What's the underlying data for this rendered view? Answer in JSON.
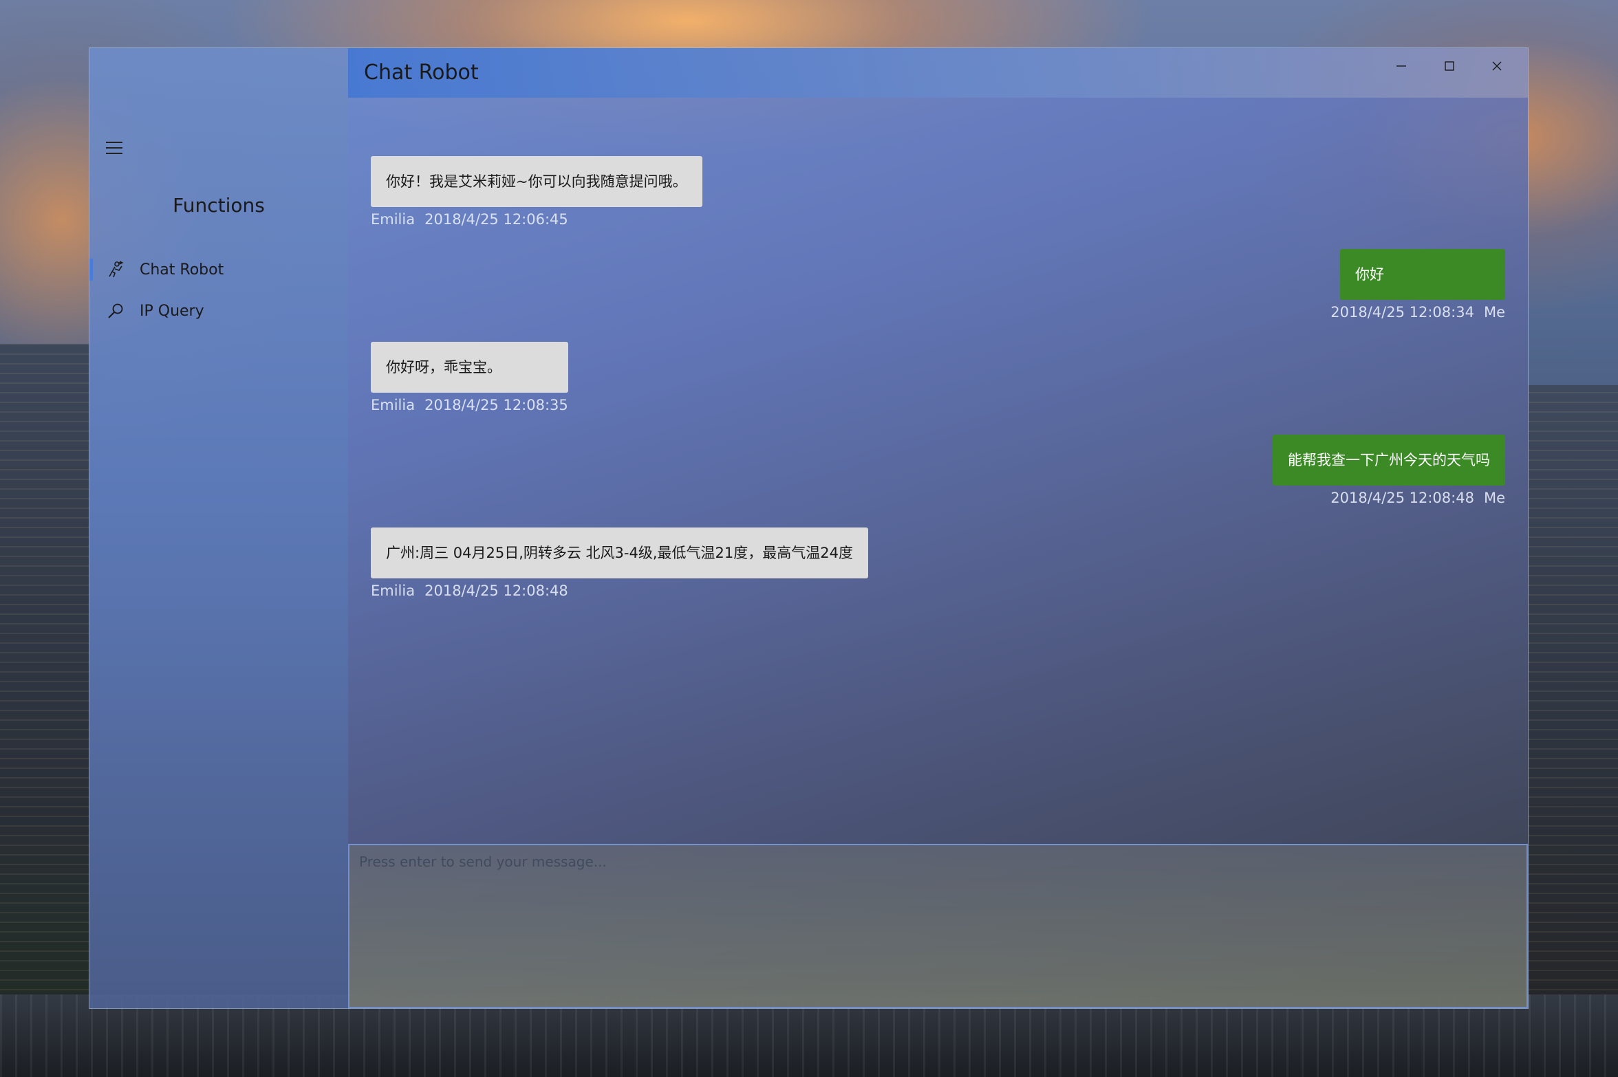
{
  "window": {
    "title": "Chat Robot",
    "caption_buttons": {
      "minimize_icon": "minimize-icon",
      "maximize_icon": "maximize-icon",
      "close_icon": "close-icon"
    }
  },
  "sidebar": {
    "menu_icon": "hamburger-icon",
    "title": "Functions",
    "items": [
      {
        "label": "Chat Robot",
        "icon": "chat-robot-icon",
        "selected": true
      },
      {
        "label": "IP Query",
        "icon": "search-icon",
        "selected": false
      }
    ],
    "accent_color": "#4a7bd6"
  },
  "messages": [
    {
      "sender": "Emilia",
      "from": "bot",
      "text": "你好！我是艾米莉娅~你可以向我随意提问哦。",
      "time": "2018/4/25 12:06:45"
    },
    {
      "sender": "Me",
      "from": "me",
      "text": "你好",
      "time": "2018/4/25 12:08:34"
    },
    {
      "sender": "Emilia",
      "from": "bot",
      "text": "你好呀，乖宝宝。",
      "time": "2018/4/25 12:08:35"
    },
    {
      "sender": "Me",
      "from": "me",
      "text": "能帮我查一下广州今天的天气吗",
      "time": "2018/4/25 12:08:48"
    },
    {
      "sender": "Emilia",
      "from": "bot",
      "text": "广州:周三 04月25日,阴转多云 北风3-4级,最低气温21度，最高气温24度",
      "time": "2018/4/25 12:08:48"
    }
  ],
  "colors": {
    "bot_bubble": "#dcdcdc",
    "me_bubble": "#3b8a26"
  },
  "input": {
    "placeholder": "Press enter to send your message...",
    "value": ""
  }
}
